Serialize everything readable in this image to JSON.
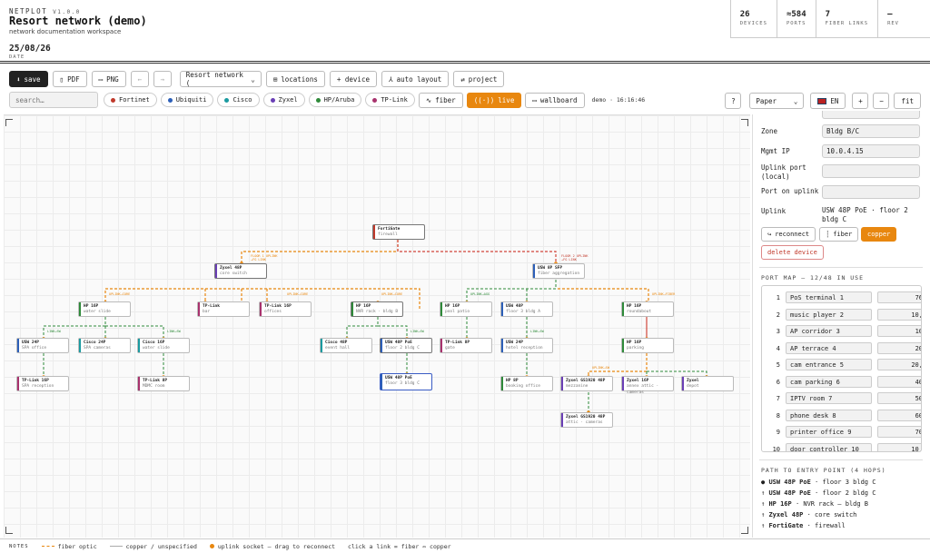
{
  "header": {
    "brand": "NETPLOT",
    "version": "V1.0.0",
    "title": "Resort network (demo)",
    "subtitle": "network documentation workspace",
    "date": "25/08/26",
    "date_label": "DATE",
    "stats": [
      {
        "value": "26",
        "label": "DEVICES"
      },
      {
        "value": "≈584",
        "label": "PORTS"
      },
      {
        "value": "7",
        "label": "FIBER LINKS"
      },
      {
        "value": "—",
        "label": "REV"
      }
    ]
  },
  "toolbar": {
    "save": "save",
    "pdf": "PDF",
    "png": "PNG",
    "undo": "←",
    "redo": "→",
    "project_select": "Resort network (",
    "locations": "locations",
    "add_device": "+ device",
    "auto_layout": "auto layout",
    "project": "project"
  },
  "filterbar": {
    "search_placeholder": "search…",
    "vendors": [
      {
        "name": "Fortinet",
        "color": "#c0392b"
      },
      {
        "name": "Ubiquiti",
        "color": "#2c5fb8"
      },
      {
        "name": "Cisco",
        "color": "#1a9aa0"
      },
      {
        "name": "Zyxel",
        "color": "#6a3fb5"
      },
      {
        "name": "HP/Aruba",
        "color": "#2f8a3a"
      },
      {
        "name": "TP-Link",
        "color": "#a8326d"
      }
    ],
    "fiber": "fiber",
    "live": "live",
    "wallboard": "wallboard",
    "clock": "demo · 16:16:46",
    "help": "?",
    "paper": "Paper",
    "lang": "EN",
    "zoom_in": "+",
    "zoom_out": "−",
    "fit": "fit"
  },
  "diagram": {
    "nodes": [
      {
        "id": "fg",
        "title": "FortiGate",
        "sub": "firewall",
        "color": "#c0392b"
      },
      {
        "id": "zy48",
        "title": "Zyxel 48P",
        "sub": "core switch",
        "color": "#6a3fb5"
      },
      {
        "id": "usw8sfp",
        "title": "USW 8P SFP",
        "sub": "fiber aggregation",
        "color": "#2c5fb8"
      },
      {
        "id": "hp16a",
        "title": "HP 16P",
        "sub": "water slide",
        "color": "#2f8a3a"
      },
      {
        "id": "tpl",
        "title": "TP-Link",
        "sub": "bar",
        "color": "#a8326d"
      },
      {
        "id": "tpl16",
        "title": "TP-Link 16P",
        "sub": "offices",
        "color": "#a8326d"
      },
      {
        "id": "hp16b",
        "title": "HP 16P",
        "sub": "NVR rack · bldg B",
        "color": "#2f8a3a"
      },
      {
        "id": "hp16c",
        "title": "HP 16P",
        "sub": "pool patio",
        "color": "#2f8a3a"
      },
      {
        "id": "usw48",
        "title": "USW 48P",
        "sub": "floor 3 bldg A",
        "color": "#2c5fb8"
      },
      {
        "id": "hp16d",
        "title": "HP 16P",
        "sub": "roundabout",
        "color": "#2f8a3a"
      },
      {
        "id": "usw24a",
        "title": "USW 24P",
        "sub": "SPA office",
        "color": "#2c5fb8"
      },
      {
        "id": "cisco24",
        "title": "Cisco 24P",
        "sub": "SPA cameras",
        "color": "#1a9aa0"
      },
      {
        "id": "cisco16",
        "title": "Cisco 16P",
        "sub": "water slide",
        "color": "#1a9aa0"
      },
      {
        "id": "cisco48",
        "title": "Cisco 48P",
        "sub": "event hall",
        "color": "#1a9aa0"
      },
      {
        "id": "usw48poe2",
        "title": "USW 48P PoE",
        "sub": "floor 2 bldg C",
        "color": "#2c5fb8"
      },
      {
        "id": "tpl8",
        "title": "TP-Link 8P",
        "sub": "gate",
        "color": "#a8326d"
      },
      {
        "id": "usw24b",
        "title": "USW 24P",
        "sub": "hotel reception",
        "color": "#2c5fb8"
      },
      {
        "id": "hp16e",
        "title": "HP 16P",
        "sub": "parking",
        "color": "#2f8a3a"
      },
      {
        "id": "tpl16b",
        "title": "TP-Link 16P",
        "sub": "SPA reception",
        "color": "#a8326d"
      },
      {
        "id": "tpl8b",
        "title": "TP-Link 8P",
        "sub": "MDMC room",
        "color": "#a8326d"
      },
      {
        "id": "usw48poe3",
        "title": "USW 48P PoE",
        "sub": "floor 3 bldg C",
        "color": "#2c5fb8"
      },
      {
        "id": "hp8",
        "title": "HP 8P",
        "sub": "booking office",
        "color": "#2f8a3a"
      },
      {
        "id": "zyxgs",
        "title": "Zyxel GS1920 48P",
        "sub": "mezzanine",
        "color": "#6a3fb5"
      },
      {
        "id": "zyx16",
        "title": "Zyxel 16P",
        "sub": "annex attic · cameras",
        "color": "#6a3fb5"
      },
      {
        "id": "zyx",
        "title": "Zyxel",
        "sub": "depot",
        "color": "#6a3fb5"
      },
      {
        "id": "zyxgs2",
        "title": "Zyxel GS1920 48P",
        "sub": "attic · cameras",
        "color": "#6a3fb5"
      }
    ]
  },
  "sidebar": {
    "zone_label": "Zone",
    "zone_value": "Bldg B/C",
    "mgmt_label": "Mgmt IP",
    "mgmt_value": "10.0.4.15",
    "uplink_local_label": "Uplink port (local)",
    "port_on_uplink_label": "Port on uplink",
    "uplink_label": "Uplink",
    "uplink_value": "USW 48P PoE · floor 2 bldg C",
    "reconnect": "reconnect",
    "fiber": "fiber",
    "copper": "copper",
    "delete": "delete device",
    "portmap_title": "PORT MAP — 12/48 IN USE",
    "ports": [
      {
        "n": "1",
        "name": "PoS terminal 1",
        "num": "76"
      },
      {
        "n": "2",
        "name": "music player 2",
        "num": "10,"
      },
      {
        "n": "3",
        "name": "AP corridor 3",
        "num": "10"
      },
      {
        "n": "4",
        "name": "AP terrace 4",
        "num": "20"
      },
      {
        "n": "5",
        "name": "cam entrance 5",
        "num": "20,"
      },
      {
        "n": "6",
        "name": "cam parking 6",
        "num": "40"
      },
      {
        "n": "7",
        "name": "IPTV room 7",
        "num": "50"
      },
      {
        "n": "8",
        "name": "phone desk 8",
        "num": "60"
      },
      {
        "n": "9",
        "name": "printer office 9",
        "num": "70"
      },
      {
        "n": "10",
        "name": "door controller 10",
        "num": "10,"
      }
    ],
    "path_title": "PATH TO ENTRY POINT (4 HOPS)",
    "path": [
      {
        "mark": "●",
        "name": "USW 48P PoE",
        "loc": "· floor 3 bldg C"
      },
      {
        "mark": "↑",
        "name": "USW 48P PoE",
        "loc": "· floor 2 bldg C"
      },
      {
        "mark": "↑",
        "name": "HP 16P",
        "loc": "· NVR rack — bldg B"
      },
      {
        "mark": "↑",
        "name": "Zyxel 48P",
        "loc": "· core switch"
      },
      {
        "mark": "↑",
        "name": "FortiGate",
        "loc": "· firewall"
      }
    ]
  },
  "footer": {
    "notes": "NOTES",
    "fiber": "fiber optic",
    "copper": "copper / unspecified",
    "uplink": "uplink socket — drag to reconnect",
    "hint": "click a link = fiber ⇔ copper"
  },
  "colors": {
    "accent": "#e8870f",
    "fiber": "#e8870f",
    "copper": "#2f8a3a",
    "selected": "#3a5cc4"
  }
}
